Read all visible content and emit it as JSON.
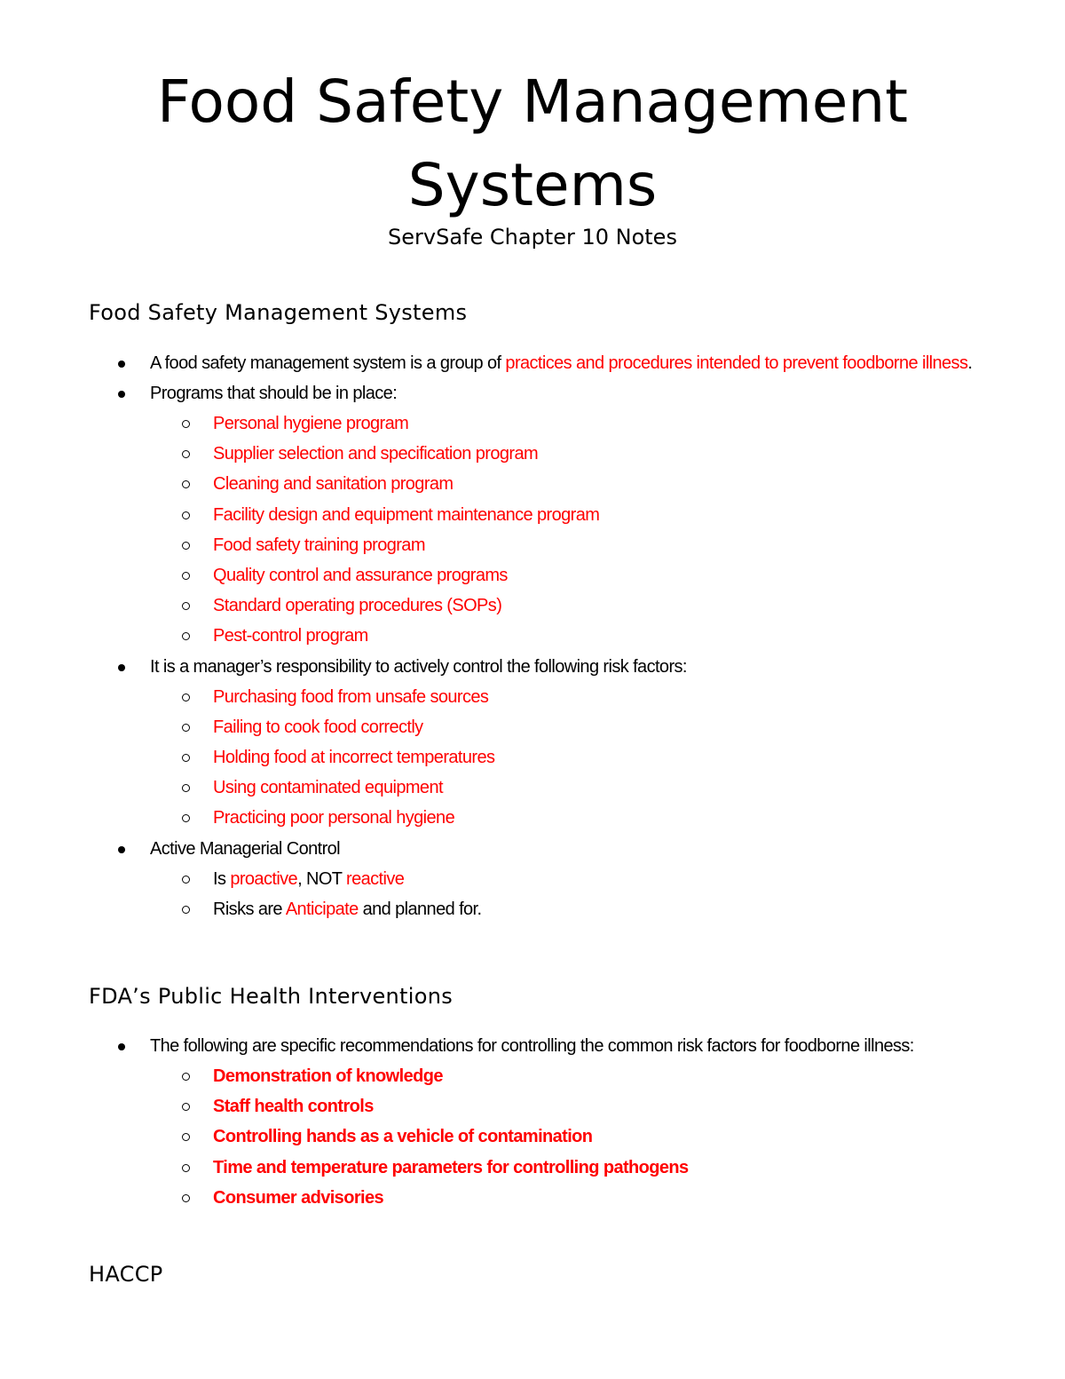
{
  "document": {
    "title_line1": "Food Safety Management",
    "title_line2": "Systems",
    "subtitle": "ServSafe Chapter 10 Notes",
    "accent_color": "#ff0000"
  },
  "section1": {
    "heading": "Food Safety Management Systems",
    "bullet1": {
      "prefix": "A food safety management system is a group of ",
      "highlight": "practices and procedures intended to prevent foodborne illness",
      "suffix": "."
    },
    "bullet2": {
      "text": "Programs that should be in place:",
      "items": [
        "Personal hygiene program",
        "Supplier selection and specification program",
        "Cleaning and sanitation program",
        "Facility design and equipment maintenance program",
        "Food safety training program",
        "Quality control and assurance programs",
        "Standard operating procedures (SOPs)",
        "Pest-control program"
      ]
    },
    "bullet3": {
      "text": "It is a manager’s responsibility to actively control the following risk factors:",
      "items": [
        "Purchasing food from unsafe sources",
        "Failing to cook food correctly",
        "Holding food at incorrect temperatures",
        "Using contaminated equipment",
        "Practicing poor personal hygiene"
      ]
    },
    "bullet4": {
      "text": "Active Managerial Control",
      "sub1": {
        "a": "Is ",
        "b": "proactive",
        "c": ", NOT ",
        "d": "reactive"
      },
      "sub2": {
        "a": "Risks are ",
        "b": "Anticipate",
        "c": " and planned for."
      }
    }
  },
  "section2": {
    "heading": "FDA’s Public Health Interventions",
    "bullet1": {
      "text": "The following are specific recommendations for controlling the common risk factors for foodborne illness:",
      "items": [
        "Demonstration of knowledge",
        "Staff health controls",
        "Controlling hands as a vehicle of contamination",
        "Time and temperature parameters for controlling pathogens",
        "Consumer advisories"
      ]
    }
  },
  "section3": {
    "heading": "HACCP"
  }
}
